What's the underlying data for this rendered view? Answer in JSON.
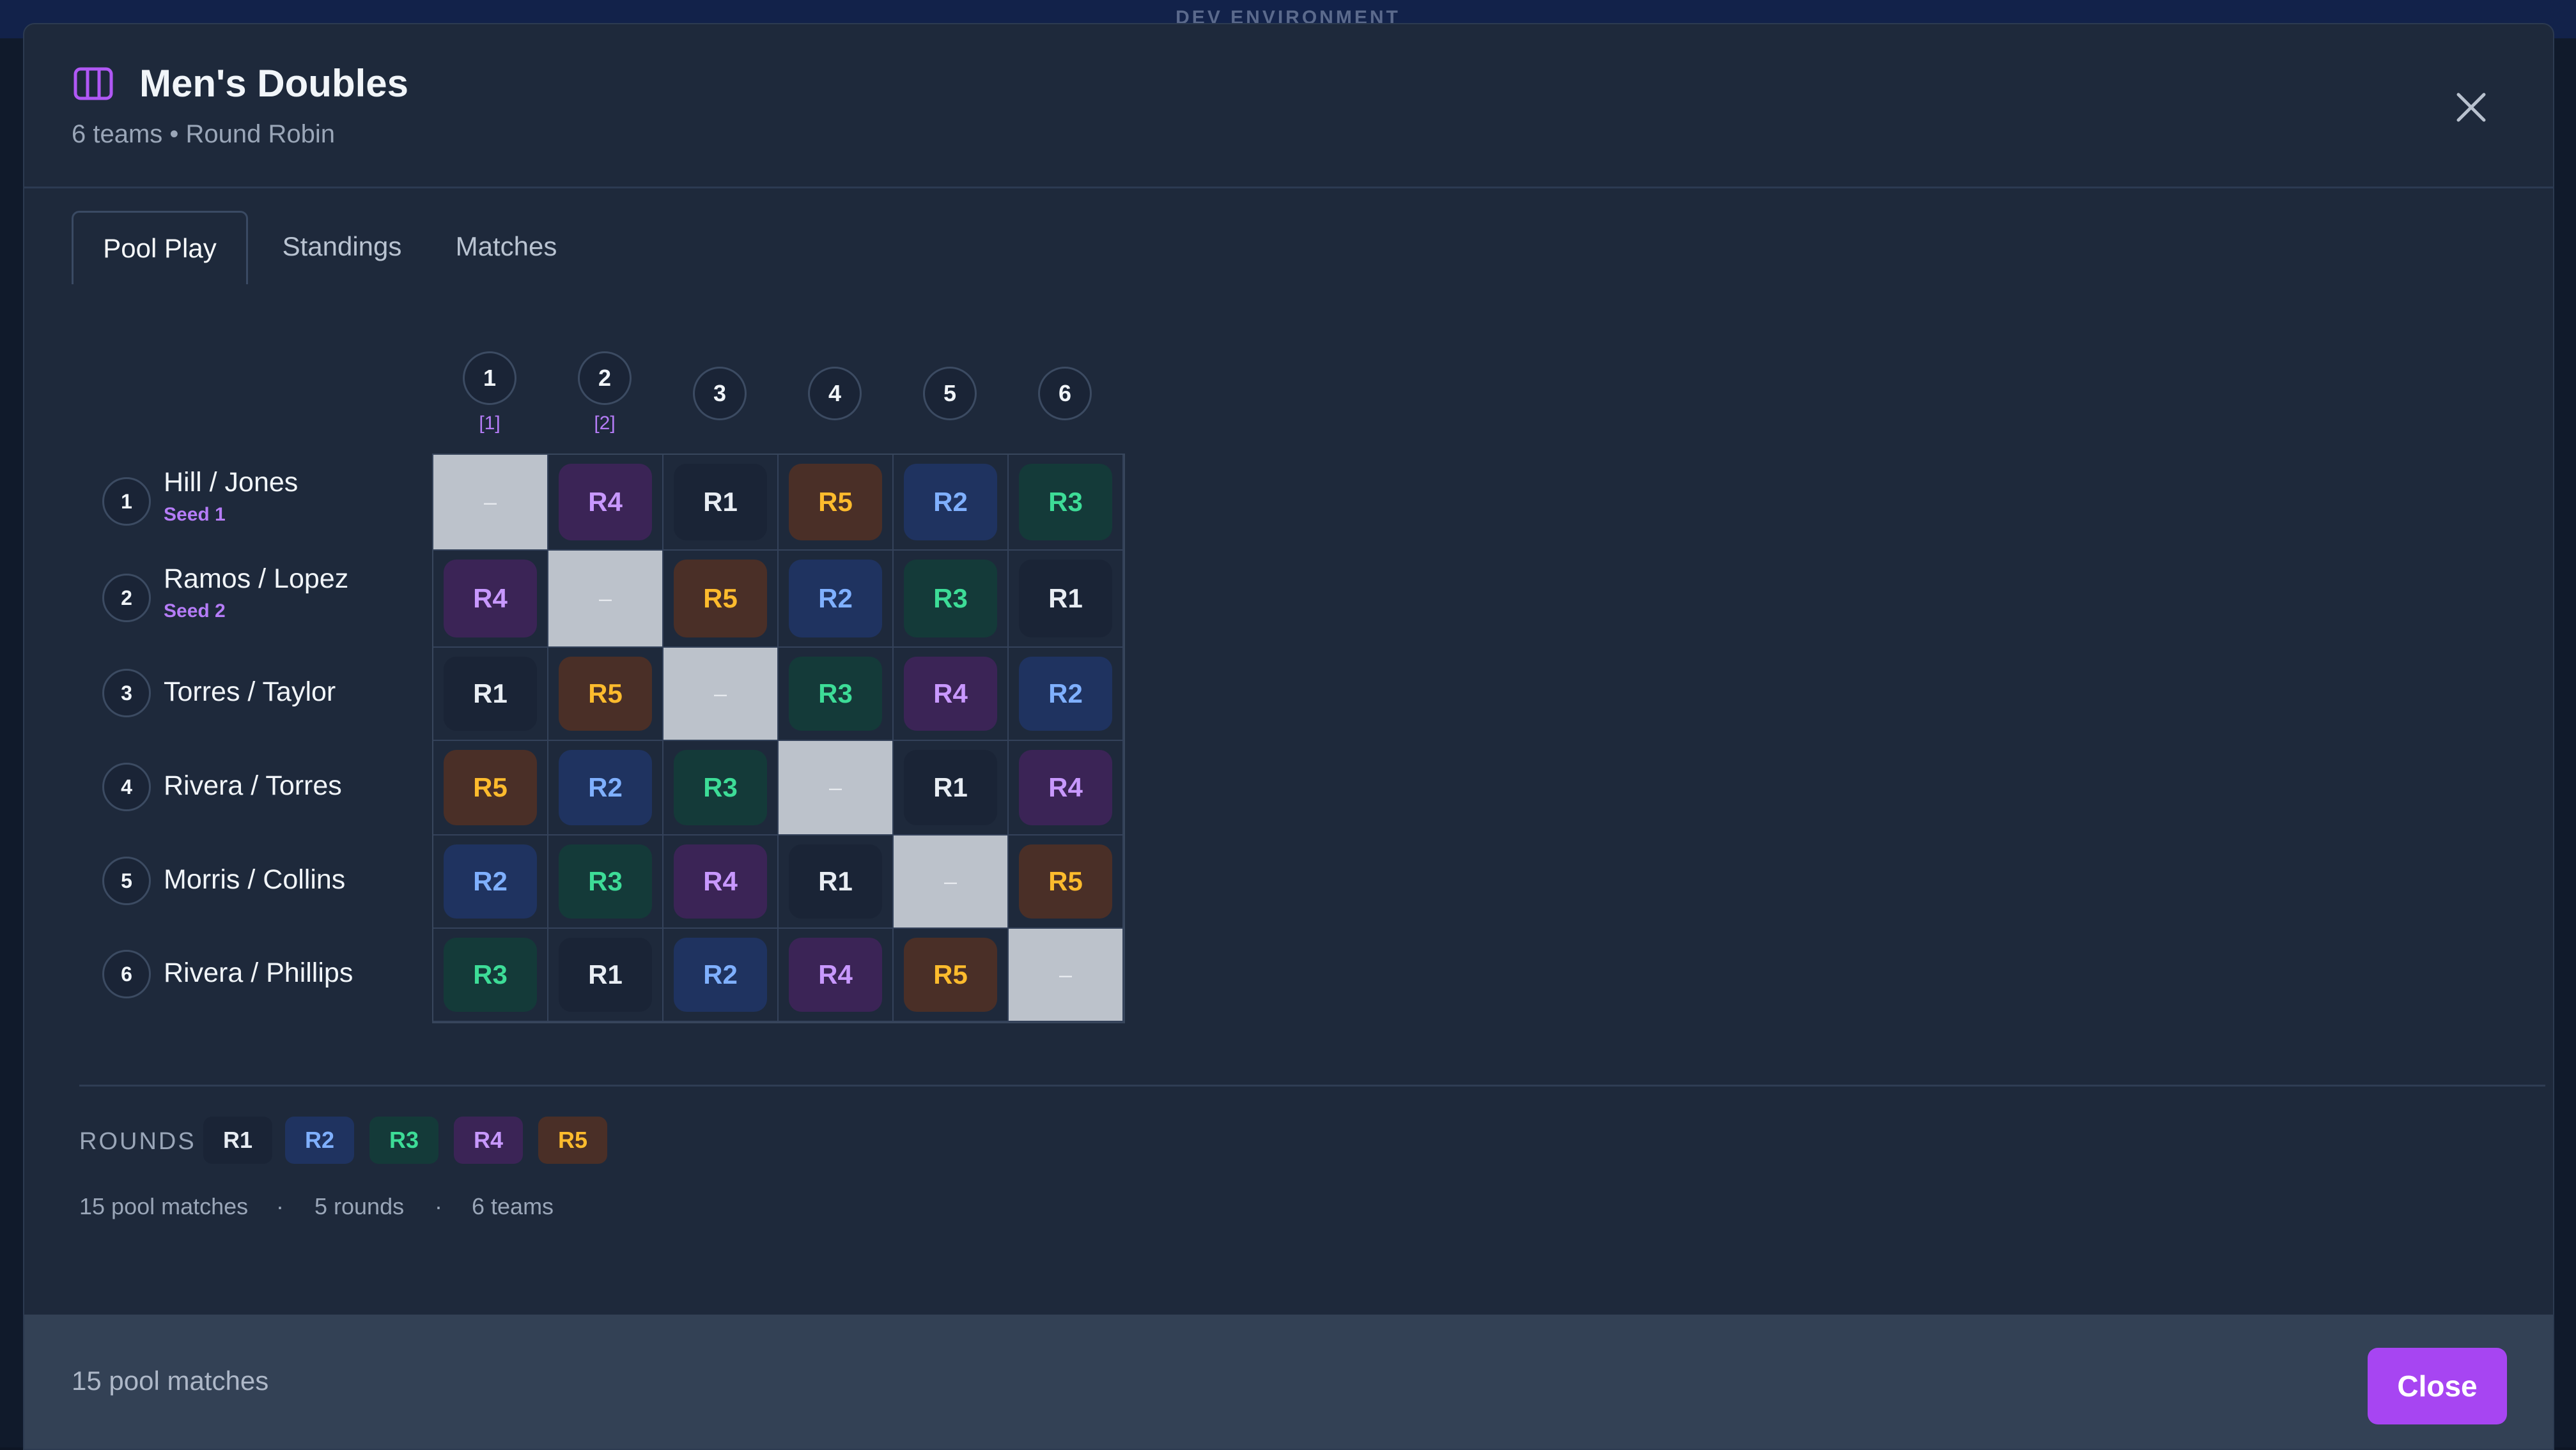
{
  "env_banner": "DEV ENVIRONMENT",
  "modal": {
    "title": "Men's Doubles",
    "subtitle": "6 teams • Round Robin"
  },
  "tabs": [
    {
      "label": "Pool Play",
      "active": true
    },
    {
      "label": "Standings",
      "active": false
    },
    {
      "label": "Matches",
      "active": false
    }
  ],
  "columns": [
    {
      "num": "1",
      "seed_tag": "[1]"
    },
    {
      "num": "2",
      "seed_tag": "[2]"
    },
    {
      "num": "3",
      "seed_tag": ""
    },
    {
      "num": "4",
      "seed_tag": ""
    },
    {
      "num": "5",
      "seed_tag": ""
    },
    {
      "num": "6",
      "seed_tag": ""
    }
  ],
  "teams": [
    {
      "num": "1",
      "name": "Hill / Jones",
      "seed": "Seed 1",
      "cells": [
        "–",
        "R4",
        "R1",
        "R5",
        "R2",
        "R3"
      ]
    },
    {
      "num": "2",
      "name": "Ramos / Lopez",
      "seed": "Seed 2",
      "cells": [
        "R4",
        "–",
        "R5",
        "R2",
        "R3",
        "R1"
      ]
    },
    {
      "num": "3",
      "name": "Torres / Taylor",
      "seed": "",
      "cells": [
        "R1",
        "R5",
        "–",
        "R3",
        "R4",
        "R2"
      ]
    },
    {
      "num": "4",
      "name": "Rivera / Torres",
      "seed": "",
      "cells": [
        "R5",
        "R2",
        "R3",
        "–",
        "R1",
        "R4"
      ]
    },
    {
      "num": "5",
      "name": "Morris / Collins",
      "seed": "",
      "cells": [
        "R2",
        "R3",
        "R4",
        "R1",
        "–",
        "R5"
      ]
    },
    {
      "num": "6",
      "name": "Rivera / Phillips",
      "seed": "",
      "cells": [
        "R3",
        "R1",
        "R2",
        "R4",
        "R5",
        "–"
      ]
    }
  ],
  "round_colors": {
    "R1": {
      "bg": "#1a2436",
      "fg": "#e8edf3"
    },
    "R2": {
      "bg": "#1f3360",
      "fg": "#7fb0ff"
    },
    "R3": {
      "bg": "#143a39",
      "fg": "#3ddc97"
    },
    "R4": {
      "bg": "#3b2456",
      "fg": "#c898ff"
    },
    "R5": {
      "bg": "#4a2f27",
      "fg": "#fdbb2d"
    }
  },
  "legend": {
    "label": "ROUNDS",
    "items": [
      "R1",
      "R2",
      "R3",
      "R4",
      "R5"
    ]
  },
  "stats": [
    "15 pool matches",
    "·",
    "5 rounds",
    "·",
    "6 teams"
  ],
  "footer": {
    "summary": "15 pool matches",
    "close_label": "Close"
  }
}
